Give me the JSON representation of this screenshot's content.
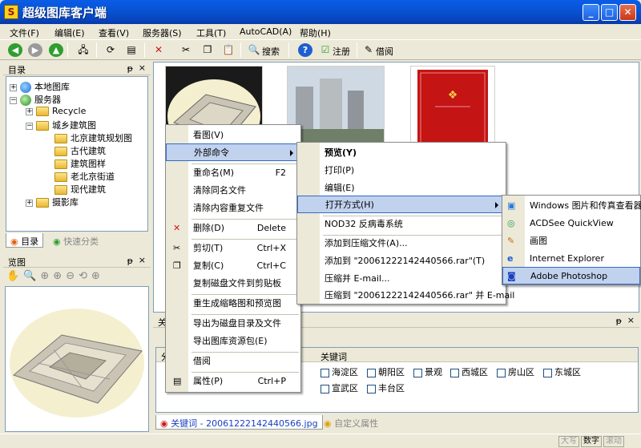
{
  "window": {
    "title": "超级图库客户端",
    "icon_letter": "S",
    "minimize": "_",
    "maximize": "□",
    "close": "✕"
  },
  "menubar": [
    "文件(F)",
    "编辑(E)",
    "查看(V)",
    "服务器(S)",
    "工具(T)",
    "AutoCAD(A)",
    "帮助(H)"
  ],
  "toolbar": {
    "search": "搜索",
    "register": "注册",
    "borrow": "借阅"
  },
  "left_panel": {
    "title": "目录",
    "pin": "ᵽ",
    "close": "×",
    "tree": {
      "local": "本地图库",
      "server": "服务器",
      "recycle": "Recycle",
      "urban": "城乡建筑图",
      "children": [
        "北京建筑规划图",
        "古代建筑",
        "建筑图样",
        "老北京街道",
        "现代建筑"
      ],
      "photo": "摄影库"
    },
    "tabs": [
      "目录",
      "快速分类"
    ]
  },
  "preview_panel": {
    "title": "览图",
    "pin": "ᵽ",
    "close": "×"
  },
  "bottom_panel": {
    "title": "关键词",
    "pin": "ᵽ",
    "close": "×",
    "col_left": "分",
    "col_right": "关键词",
    "keywords_row1": [
      "海淀区",
      "朝阳区",
      "景观",
      "西城区",
      "房山区",
      "东城区"
    ],
    "keywords_row2": [
      "宣武区",
      "丰台区"
    ],
    "tabs": [
      "关键词 - 20061222142440566.jpg",
      "自定义属性"
    ]
  },
  "context_menu": [
    {
      "label": "看图(V)",
      "shortcut": ""
    },
    {
      "label": "外部命令",
      "shortcut": "",
      "submenu": true
    },
    {
      "label": "重命名(M)",
      "shortcut": "F2"
    },
    {
      "label": "清除同名文件",
      "shortcut": ""
    },
    {
      "label": "清除内容重复文件",
      "shortcut": ""
    },
    {
      "label": "删除(D)",
      "shortcut": "Delete"
    },
    {
      "label": "剪切(T)",
      "shortcut": "Ctrl+X"
    },
    {
      "label": "复制(C)",
      "shortcut": "Ctrl+C"
    },
    {
      "label": "复制磁盘文件到剪贴板",
      "shortcut": ""
    },
    {
      "label": "重生成缩略图和预览图",
      "shortcut": ""
    },
    {
      "label": "导出为磁盘目录及文件",
      "shortcut": ""
    },
    {
      "label": "导出图库资源包(E)",
      "shortcut": ""
    },
    {
      "label": "借阅",
      "shortcut": ""
    },
    {
      "label": "属性(P)",
      "shortcut": "Ctrl+P"
    }
  ],
  "external_menu": [
    "预览(Y)",
    "打印(P)",
    "编辑(E)",
    "打开方式(H)",
    "NOD32 反病毒系统",
    "添加到压缩文件(A)...",
    "添加到 \"20061222142440566.rar\"(T)",
    "压缩并 E-mail...",
    "压缩到 \"20061222142440566.rar\" 并 E-mail"
  ],
  "open_with_menu": [
    "Windows 图片和传真查看器",
    "ACDSee QuickView",
    "画图",
    "Internet Explorer",
    "Adobe Photoshop"
  ],
  "statusbar": [
    "大写",
    "数字",
    "滚动"
  ],
  "colors": {
    "highlight": "#c1d2ee",
    "highlight_border": "#316ac5",
    "titlebar": "#0854d4"
  }
}
